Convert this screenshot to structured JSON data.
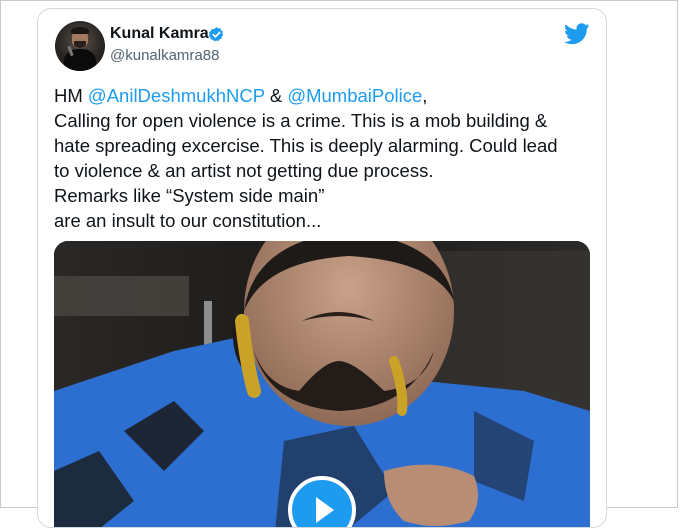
{
  "tweet": {
    "author_name": "Kunal Kamra",
    "author_handle": "@kunalkamra88",
    "lines": {
      "l1_prefix": "HM ",
      "l1_mention1": "@AnilDeshmukhNCP",
      "l1_mid": " & ",
      "l1_mention2": "@MumbaiPolice",
      "l1_suffix": ",",
      "l2": "Calling for open violence is a crime. This is a mob building &",
      "l3": "hate spreading excercise. This is deeply alarming. Could lead",
      "l4": "to violence & an artist not getting due process.",
      "l5": "Remarks like “System side main”",
      "l6": "are an insult to our constitution..."
    }
  },
  "icons": {
    "verified": "verified-badge-icon",
    "platform": "twitter-bird-icon",
    "play": "play-icon"
  },
  "colors": {
    "accent": "#1d9bf0",
    "text": "#0f1419",
    "muted": "#536471",
    "shirt_blue": "#2c6fd1"
  }
}
